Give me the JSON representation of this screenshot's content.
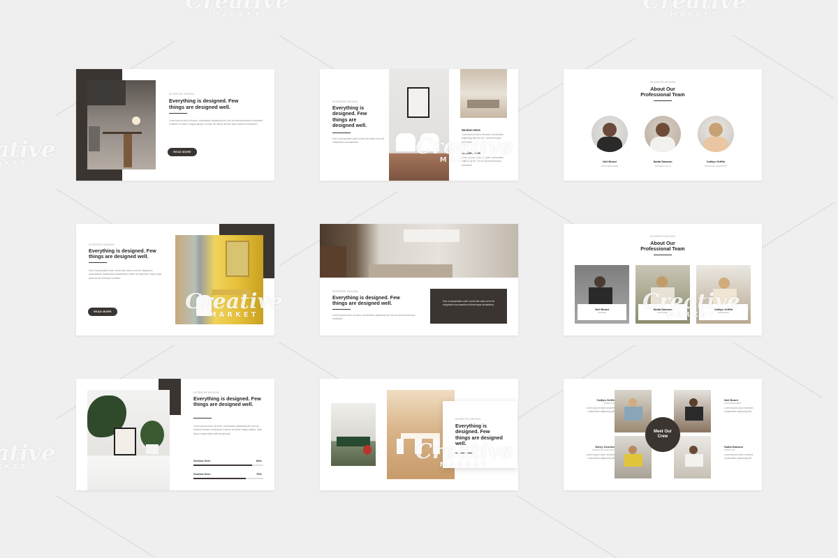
{
  "watermark": {
    "brand": "Creative",
    "sub": "MARKET"
  },
  "slide1": {
    "label": "INTERIOR DESIGN",
    "heading": "Everything is designed. Few things are designed well.",
    "paragraph": "Lorem ipsum dolor sit amet, consectetur adipiscing elit, sed do eiusmod tempor incididunt ut labore et dolore magna aliqua. Ut enim ad minim veniam quis nostrud exercitation.",
    "button": "READ MORE"
  },
  "slide2": {
    "label": "INTERIOR DESIGN",
    "heading": "Everything is designed. Few things are designed well.",
    "paragraph": "Sed ut perspiciatis unde omnis iste natus error sit voluptatem accusantium.",
    "section1_title": "Section Here",
    "section1_text": "Lorem ipsum dolor sit amet, consectetur adipiscing elit sed do eiusmod tempor incididunt.",
    "section2_title": "Section Here",
    "section2_text": "Lorem ipsum dolor sit amet, consectetur adipiscing elit sed do eiusmod tempor incididunt."
  },
  "slide3": {
    "label": "INTERIOR DESIGN",
    "heading": "About Our Professional Team",
    "members": [
      {
        "name": "Neil Beard",
        "role": "LEAD DESIGNER"
      },
      {
        "name": "Sadia Dawson",
        "role": "OWNER & C.E.O"
      },
      {
        "name": "Caitlyn Griffin",
        "role": "FINANCIAL ASSISTANT"
      }
    ]
  },
  "slide4": {
    "label": "INTERIOR DESIGN",
    "heading": "Everything is designed. Few things are designed well.",
    "paragraph": "Sed ut perspiciatis unde omnis iste natus error sit voluptatem accusantium doloremque laudantium, totam rem aperiam, eaque ipsa quae ab illo inventore veritatis.",
    "button": "READ MORE"
  },
  "slide5": {
    "label": "INTERIOR DESIGN",
    "heading": "Everything is designed. Few things are designed well.",
    "paragraph": "Lorem ipsum dolor sit amet, consectetur adipiscing elit, sed do eiusmod tempor incididunt.",
    "box_text": "Sed ut perspiciatis unde omnis iste natus error sit voluptatem accusantium doloremque laudantium."
  },
  "slide6": {
    "label": "INTERIOR DESIGN",
    "heading": "About Our Professional Team",
    "members": [
      {
        "name": "Neil Beard",
        "role": "LEADER"
      },
      {
        "name": "Sadia Dawson",
        "role": "MANAGER"
      },
      {
        "name": "Caitlyn Griffin",
        "role": "DESIGNER"
      }
    ]
  },
  "slide7": {
    "label": "INTERIOR DESIGN",
    "heading": "Everything is designed. Few things are designed well.",
    "paragraph": "Lorem ipsum dolor sit amet, consectetur adipiscing elit, sed do eiusmod tempor incididunt ut labore et dolore magna aliqua. Quis ipsum suspendisse ultrices gravida.",
    "skills": [
      {
        "name": "Section Here",
        "percent": "84%",
        "value": 0.84
      },
      {
        "name": "Section Here",
        "percent": "75%",
        "value": 0.75
      }
    ]
  },
  "slide8": {
    "label": "INTERIOR DESIGN",
    "heading": "Everything is designed. Few things are designed well."
  },
  "slide9": {
    "center": "Meet Our Crew",
    "people": [
      {
        "name": "Caitlyn Griffin",
        "role": "DIRECTOR",
        "text": "Lorem ipsum dolor sit amet, consectetur adipiscing elit."
      },
      {
        "name": "Neil Beard",
        "role": "LEAD DESIGNER",
        "text": "Lorem ipsum dolor sit amet, consectetur adipiscing elit."
      },
      {
        "name": "Darcy Oconner",
        "role": "FINANCIAL ASSISTANT",
        "text": "Lorem ipsum dolor sit amet, consectetur adipiscing elit."
      },
      {
        "name": "Sadia Dawson",
        "role": "INVESTOR",
        "text": "Lorem ipsum dolor sit amet, consectetur adipiscing elit."
      }
    ]
  },
  "colors": {
    "background": "#efefef",
    "accent_dark": "#3b3532",
    "slide_bg": "#ffffff"
  }
}
